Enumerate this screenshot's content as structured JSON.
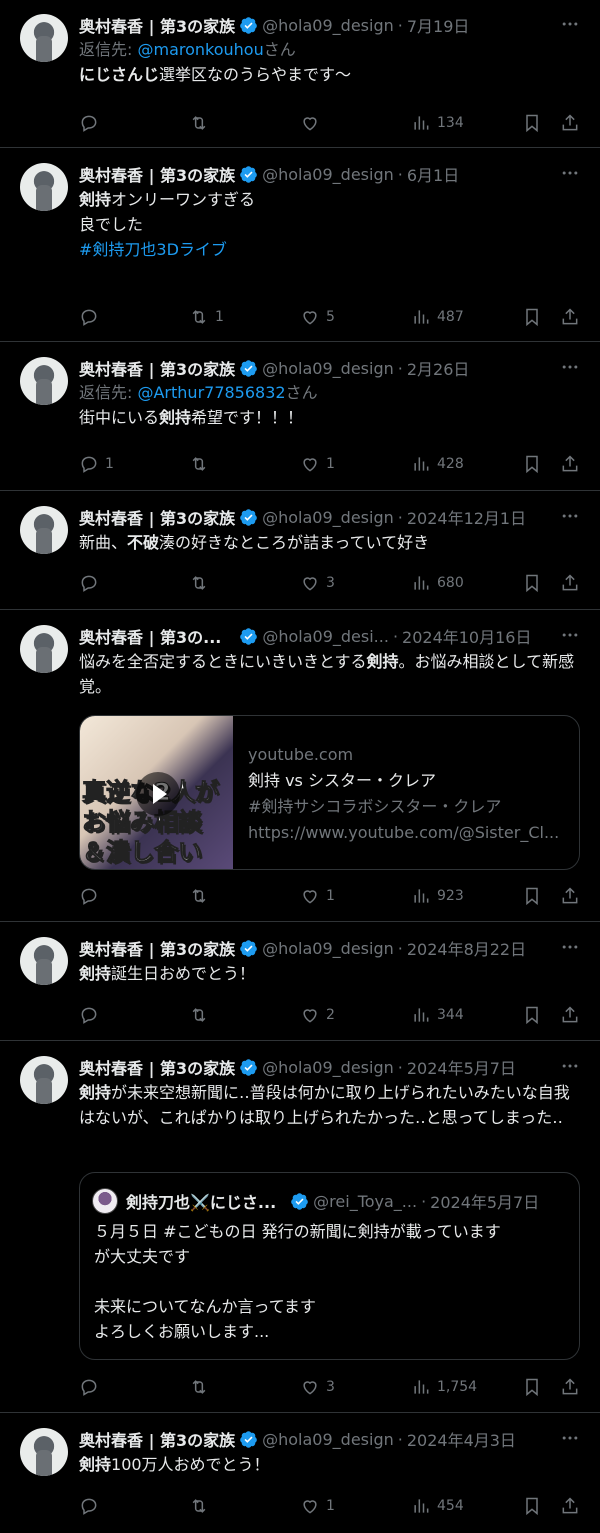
{
  "tweets": [
    {
      "name": "奥村春香 | 第3の家族",
      "handle": "@hola09_design",
      "date": "7月19日",
      "reply_prefix": "返信先: ",
      "reply_mention": "@maronkouhou",
      "reply_suffix": "さん",
      "text_bold": "にじさんじ",
      "text_rest": "選挙区なのうらやまです〜",
      "replies": "",
      "retweets": "",
      "likes": "",
      "views": "134"
    },
    {
      "name": "奥村春香 | 第3の家族",
      "handle": "@hola09_design",
      "date": "6月1日",
      "text_bold": "剣持",
      "text_rest": "オンリーワンすぎる\n良でした\n",
      "hashtag": "#剣持刀也3Dライブ",
      "replies": "",
      "retweets": "1",
      "likes": "5",
      "views": "487"
    },
    {
      "name": "奥村春香 | 第3の家族",
      "handle": "@hola09_design",
      "date": "2月26日",
      "reply_prefix": "返信先: ",
      "reply_mention": "@Arthur77856832",
      "reply_suffix": "さん",
      "text_pre": "街中にいる",
      "text_bold": "剣持",
      "text_rest": "希望です！！！",
      "replies": "1",
      "retweets": "",
      "likes": "1",
      "views": "428"
    },
    {
      "name": "奥村春香 | 第3の家族",
      "handle": "@hola09_design",
      "date": "2024年12月1日",
      "text_pre": "新曲、",
      "text_bold": "不破",
      "text_rest": "湊の好きなところが詰まっていて好き",
      "replies": "",
      "retweets": "",
      "likes": "3",
      "views": "680"
    },
    {
      "name": "奥村春香 | 第3の...",
      "handle": "@hola09_desi...",
      "date": "2024年10月16日",
      "text_pre": "悩みを全否定するときにいきいきとする",
      "text_bold": "剣持",
      "text_rest": "。お悩み相談として新感覚。",
      "card": {
        "image_text": "真逆な2人が\nお悩み相談\n＆潰し合い",
        "domain": "youtube.com",
        "title": "剣持 vs シスター・クレア",
        "desc": "#剣持サシコラボシスター・クレア",
        "url": "https://www.youtube.com/@Sister_Cl..."
      },
      "replies": "",
      "retweets": "",
      "likes": "1",
      "views": "923"
    },
    {
      "name": "奥村春香 | 第3の家族",
      "handle": "@hola09_design",
      "date": "2024年8月22日",
      "text_bold": "剣持",
      "text_rest": "誕生日おめでとう！",
      "replies": "",
      "retweets": "",
      "likes": "2",
      "views": "344"
    },
    {
      "name": "奥村春香 | 第3の家族",
      "handle": "@hola09_design",
      "date": "2024年5月7日",
      "text_bold": "剣持",
      "text_rest": "が未来空想新聞に‥普段は何かに取り上げられたいみたいな自我はないが、これぱかりは取り上げられたかった‥と思ってしまった‥",
      "quote": {
        "name": "剣持刀也⚔️にじさ...",
        "handle": "@rei_Toya_...",
        "date": "2024年5月7日",
        "text": "５月５日 #こどもの日 発行の新聞に剣持が載っています\nが大丈夫です\n\n未来についてなんか言ってます\nよろしくお願いします..."
      },
      "replies": "",
      "retweets": "",
      "likes": "3",
      "views": "1,754"
    },
    {
      "name": "奥村春香 | 第3の家族",
      "handle": "@hola09_design",
      "date": "2024年4月3日",
      "text_bold": "剣持",
      "text_rest": "100万人おめでとう！",
      "replies": "",
      "retweets": "",
      "likes": "1",
      "views": "454"
    }
  ],
  "icons": [
    "reply-icon",
    "retweet-icon",
    "like-icon",
    "views-icon",
    "bookmark-icon",
    "share-icon",
    "more-icon",
    "verified-icon"
  ],
  "colors": {
    "background": "#000000",
    "text": "#e7e9ea",
    "muted": "#71767b",
    "link": "#1d9bf0",
    "border": "#2f3336",
    "verified": "#1d9bf0"
  }
}
